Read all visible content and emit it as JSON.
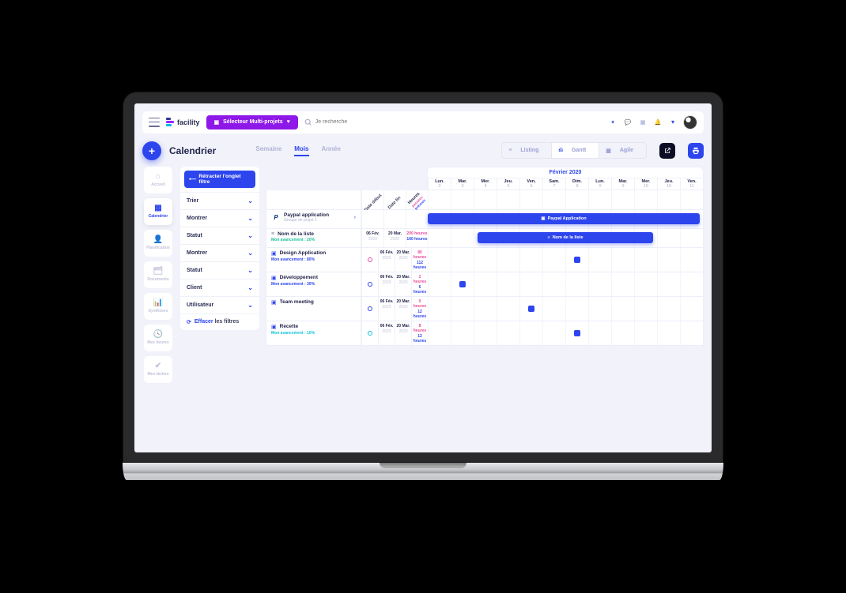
{
  "header": {
    "brand": "facility",
    "multi_projects": "Sélecteur Multi-projets",
    "search_placeholder": "Je recherche"
  },
  "page": {
    "title": "Calendrier",
    "periods": {
      "week": "Semaine",
      "month": "Mois",
      "year": "Année",
      "active": "month"
    },
    "views": {
      "listing": "Listing",
      "gantt": "Gantt",
      "agile": "Agile",
      "active": "gantt"
    }
  },
  "sidebar": [
    {
      "label": "Accueil",
      "icon": "home"
    },
    {
      "label": "Calendrier",
      "icon": "calendar",
      "active": true
    },
    {
      "label": "Planification",
      "icon": "user"
    },
    {
      "label": "Documents",
      "icon": "folder"
    },
    {
      "label": "Synthèses",
      "icon": "chart"
    },
    {
      "label": "Mes heures",
      "icon": "clock"
    },
    {
      "label": "Mes tâches",
      "icon": "check"
    }
  ],
  "filters": {
    "retract": "Rétracter l'onglet filtre",
    "items": [
      "Trier",
      "Montrer",
      "Statut",
      "Montrer",
      "Statut",
      "Client",
      "Utilisateur"
    ],
    "clear_prefix": "Effacer",
    "clear_suffix": "les filtres"
  },
  "calendar": {
    "month_label": "Février 2020",
    "date_headers": {
      "start": "Date début",
      "end": "Date fin",
      "hours": "Heures",
      "hp1": "passées",
      "hp2": "prévues"
    },
    "days": [
      {
        "d": "Lun.",
        "n": "2"
      },
      {
        "d": "Mar.",
        "n": "3"
      },
      {
        "d": "Mer.",
        "n": "4"
      },
      {
        "d": "Jeu.",
        "n": "5"
      },
      {
        "d": "Ven.",
        "n": "6"
      },
      {
        "d": "Sam.",
        "n": "7"
      },
      {
        "d": "Dim.",
        "n": "8"
      },
      {
        "d": "Lun.",
        "n": "9"
      },
      {
        "d": "Mar.",
        "n": "9"
      },
      {
        "d": "Mer.",
        "n": "10"
      },
      {
        "d": "Jeu.",
        "n": "10"
      },
      {
        "d": "Ven.",
        "n": "11"
      }
    ],
    "project": {
      "name": "Paypal application",
      "group": "Groupe de projet 1",
      "bar_label": "Paypal Application"
    },
    "list_row": {
      "name": "Nom de la liste",
      "progress": "Mon avancement : 20%",
      "bar_label": "Nom de la liste"
    },
    "tasks": [
      {
        "name": "Design Application",
        "progress": "Mon avancement : 80%",
        "pcolor": "blue",
        "status": "#e84b9b",
        "h1": "80 heures",
        "h2": "112 heures",
        "mark": 6
      },
      {
        "name": "Développement",
        "progress": "Mon avancement : 30%",
        "pcolor": "blue",
        "status": "#2d45ed",
        "h1": "2 heures",
        "h2": "6 heures",
        "mark": 1
      },
      {
        "name": "Team meeting",
        "progress": "",
        "pcolor": "",
        "status": "#2d45ed",
        "h1": "0 heures",
        "h2": "12 heures",
        "mark": 4
      },
      {
        "name": "Recette",
        "progress": "Mon avancement : 10%",
        "pcolor": "cyan",
        "status": "#10c3d8",
        "h1": "8 heures",
        "h2": "12 heures",
        "mark": 6
      }
    ],
    "date_start": {
      "d": "06 Fév.",
      "y": "2020"
    },
    "date_end": {
      "d": "20 Mar.",
      "y": "2020"
    },
    "proj_hours": {
      "h1": "200 heures",
      "h2": "160 heures"
    }
  }
}
